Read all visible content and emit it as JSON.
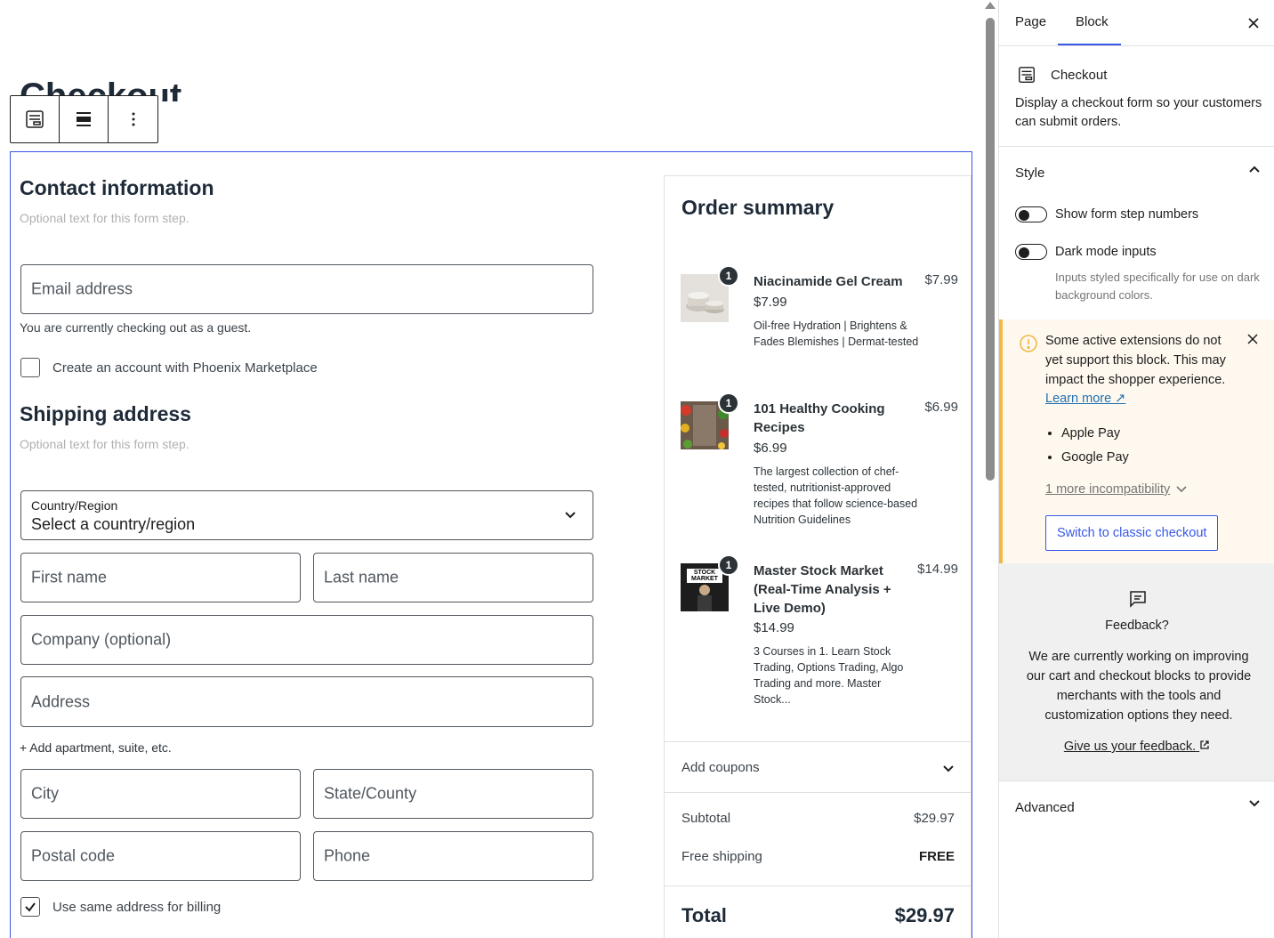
{
  "page": {
    "title": "Checkout"
  },
  "contact": {
    "title": "Contact information",
    "desc": "Optional text for this form step.",
    "email_placeholder": "Email address",
    "guest_note": "You are currently checking out as a guest.",
    "create_account_label": "Create an account with Phoenix Marketplace"
  },
  "shipping": {
    "title": "Shipping address",
    "desc": "Optional text for this form step.",
    "country_label": "Country/Region",
    "country_value": "Select a country/region",
    "first_name": "First name",
    "last_name": "Last name",
    "company": "Company (optional)",
    "address": "Address",
    "add_apartment": "+ Add apartment, suite, etc.",
    "city": "City",
    "state": "State/County",
    "postal": "Postal code",
    "phone": "Phone",
    "same_billing_label": "Use same address for billing",
    "same_billing_checked": true
  },
  "summary": {
    "title": "Order summary",
    "items": [
      {
        "qty": "1",
        "name": "Niacinamide Gel Cream",
        "price_total": "$7.99",
        "price": "$7.99",
        "desc": "Oil-free Hydration | Brightens & Fades Blemishes | Dermat-tested"
      },
      {
        "qty": "1",
        "name": "101 Healthy Cooking Recipes",
        "price_total": "$6.99",
        "price": "$6.99",
        "desc": "The largest collection of chef-tested, nutritionist-approved recipes that follow science-based Nutrition Guidelines"
      },
      {
        "qty": "1",
        "name": "Master Stock Market (Real-Time Analysis + Live Demo)",
        "price_total": "$14.99",
        "price": "$14.99",
        "desc": "3 Courses in 1. Learn Stock Trading, Options Trading, Algo Trading and more. Master Stock...",
        "thumb_text": "STOCK MARKET"
      }
    ],
    "coupons_label": "Add coupons",
    "subtotal_label": "Subtotal",
    "subtotal_value": "$29.97",
    "shipping_label": "Free shipping",
    "shipping_value": "FREE",
    "total_label": "Total",
    "total_value": "$29.97"
  },
  "sidebar": {
    "tabs": [
      "Page",
      "Block"
    ],
    "active_tab": "Block",
    "block_title": "Checkout",
    "block_desc": "Display a checkout form so your customers can submit orders.",
    "style_title": "Style",
    "toggle_step_numbers": "Show form step numbers",
    "toggle_dark_mode": "Dark mode inputs",
    "dark_mode_help": "Inputs styled specifically for use on dark background colors.",
    "notice": {
      "text": "Some active extensions do not yet support this block. This may impact the shopper experience.",
      "learn_more": "Learn more ↗",
      "list": [
        "Apple Pay",
        "Google Pay"
      ],
      "more": "1 more incompatibility",
      "button": "Switch to classic checkout"
    },
    "feedback": {
      "title": "Feedback?",
      "text": "We are currently working on improving our cart and checkout blocks to provide merchants with the tools and customization options they need.",
      "link": "Give us your feedback."
    },
    "advanced_title": "Advanced"
  },
  "colors": {
    "accent": "#3858e9",
    "notice_border": "#f0b849",
    "notice_bg": "#fef8ee",
    "link": "#2271b1"
  }
}
